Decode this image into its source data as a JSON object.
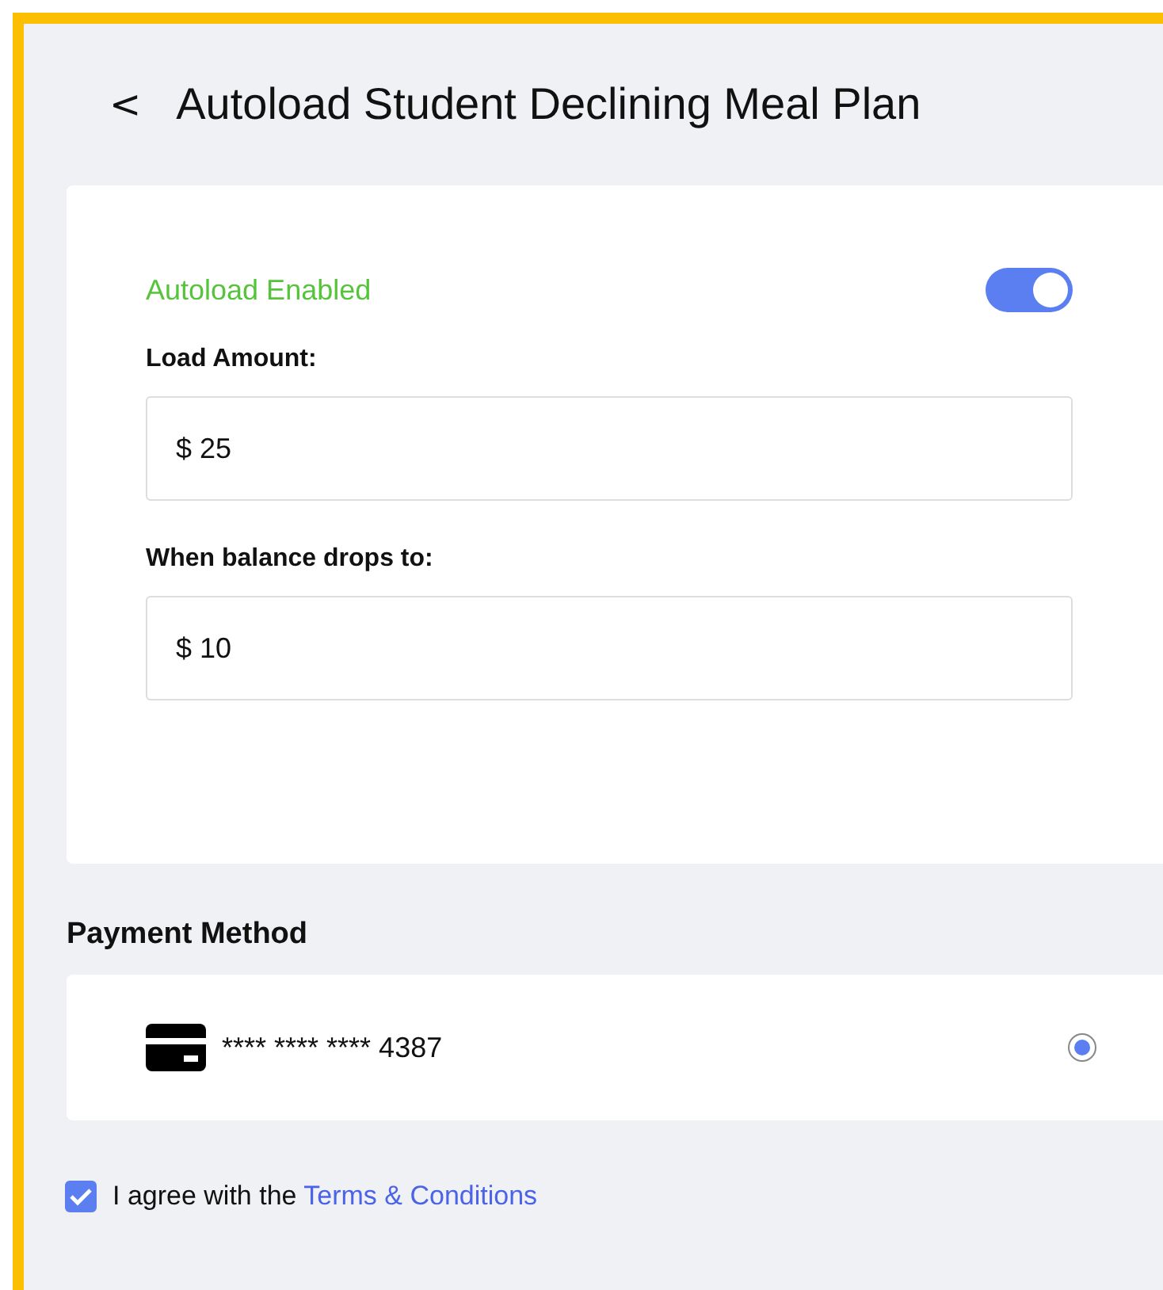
{
  "header": {
    "back_icon_label": "<",
    "title": "Autoload Student Declining Meal Plan"
  },
  "autoload": {
    "label": "Autoload Enabled",
    "on": true
  },
  "fields": [
    {
      "label": "Load Amount:",
      "value": "$ 25"
    },
    {
      "label": "When balance drops to:",
      "value": "$ 10"
    }
  ],
  "payment": {
    "heading": "Payment Method",
    "cards": [
      {
        "number": "**** **** **** 4387",
        "selected": true
      }
    ]
  },
  "terms": {
    "checked": true,
    "text": "I agree with the",
    "link": "Terms & Conditions"
  }
}
